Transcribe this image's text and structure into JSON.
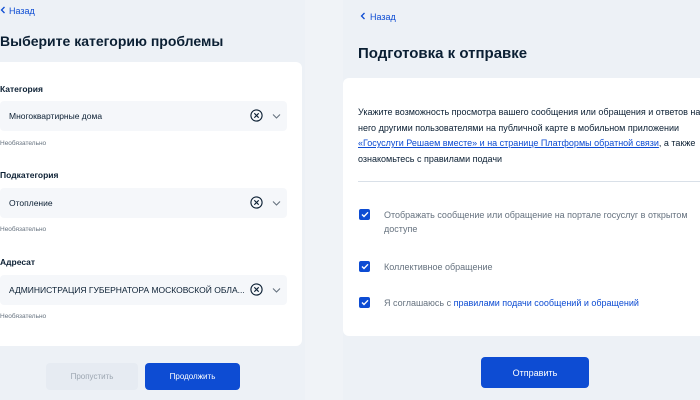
{
  "left": {
    "back_label": "Назад",
    "title": "Выберите категорию проблемы",
    "fields": [
      {
        "label": "Категория",
        "value": "Многоквартирные дома",
        "hint": "Необязательно"
      },
      {
        "label": "Подкатегория",
        "value": "Отопление",
        "hint": "Необязательно"
      },
      {
        "label": "Адресат",
        "value": "АДМИНИСТРАЦИЯ ГУБЕРНАТОРА МОСКОВСКОЙ ОБЛА...",
        "hint": "Необязательно"
      }
    ],
    "skip_label": "Пропустить",
    "continue_label": "Продолжить"
  },
  "right": {
    "back_label": "Назад",
    "title": "Подготовка к отправке",
    "intro_1": "Укажите возможность просмотра вашего сообщения или обращения и ответов на него другими пользователями на публичной карте в мобильном приложении ",
    "intro_link_1": "«Госуслуги Решаем вместе» и на странице Платформы обратной связи",
    "intro_2": ", а также ознакомьтесь с правилами подачи",
    "checkbox_1": "Отображать сообщение или обращение на портале госуслуг в открытом доступе",
    "checkbox_2": "Коллективное обращение",
    "checkbox_3_prefix": "Я соглашаюсь с ",
    "checkbox_3_link": "правилами подачи сообщений и обращений",
    "submit_label": "Отправить"
  },
  "colors": {
    "accent": "#0d4cd3",
    "background": "#edf1f6",
    "card": "#ffffff",
    "muted_text": "#66727f"
  }
}
